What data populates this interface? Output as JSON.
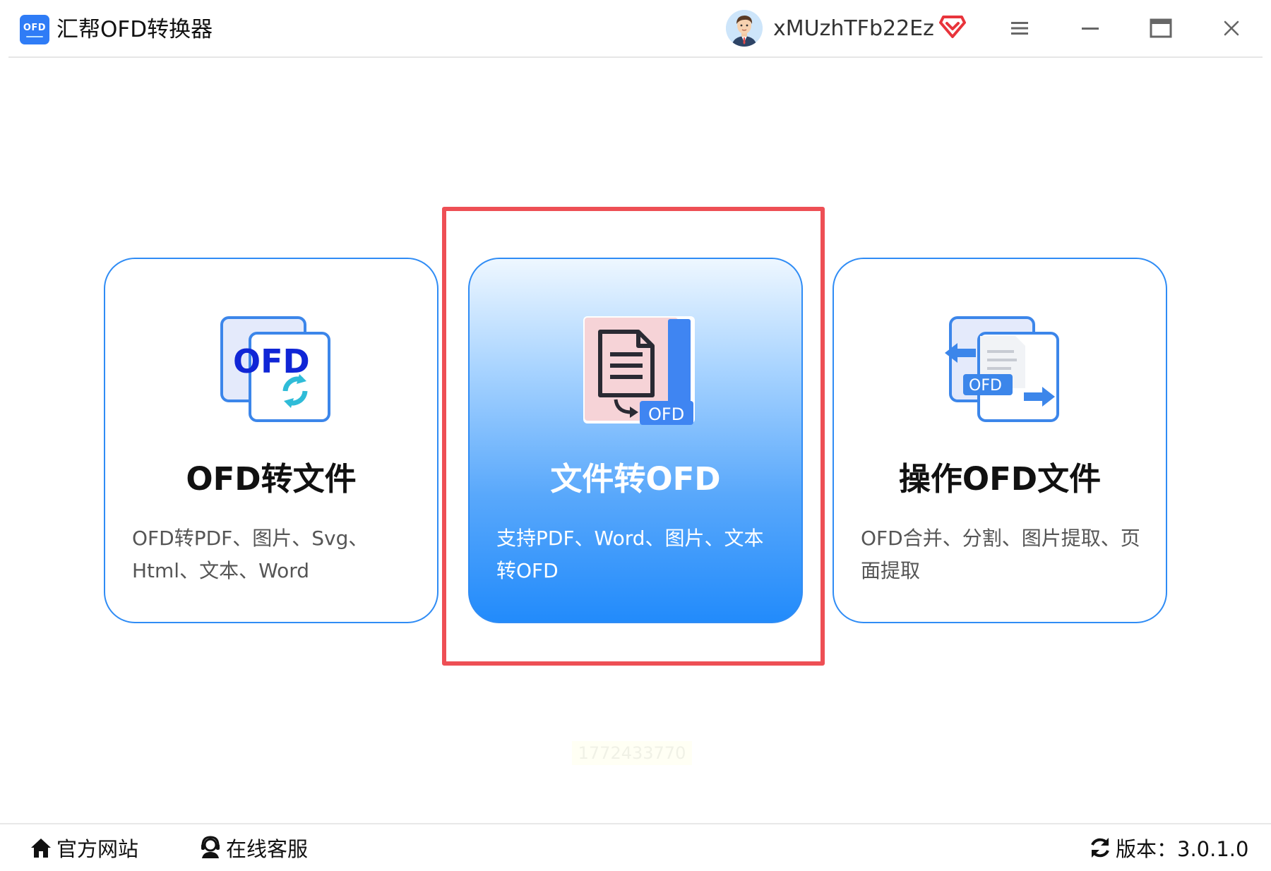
{
  "app": {
    "logo_text": "OFD",
    "title": "汇帮OFD转换器"
  },
  "user": {
    "name": "xMUzhTFb22Ez"
  },
  "window_controls": {
    "menu": "menu-icon",
    "minimize": "minimize-icon",
    "maximize": "maximize-icon",
    "close": "close-icon"
  },
  "cards": [
    {
      "title": "OFD转文件",
      "description": "OFD转PDF、图片、Svg、Html、文本、Word",
      "icon_label": "OFD",
      "selected": false
    },
    {
      "title": "文件转OFD",
      "description": "支持PDF、Word、图片、文本转OFD",
      "icon_label": "OFD",
      "selected": true
    },
    {
      "title": "操作OFD文件",
      "description": "OFD合并、分割、图片提取、页面提取",
      "icon_label": "OFD",
      "selected": false
    }
  ],
  "watermark": "1772433770",
  "footer": {
    "site": "官方网站",
    "service": "在线客服",
    "version": "版本：3.0.1.0"
  },
  "colors": {
    "accent": "#2f8cf5",
    "highlight": "#ee4f55",
    "vip": "#e8343b"
  }
}
